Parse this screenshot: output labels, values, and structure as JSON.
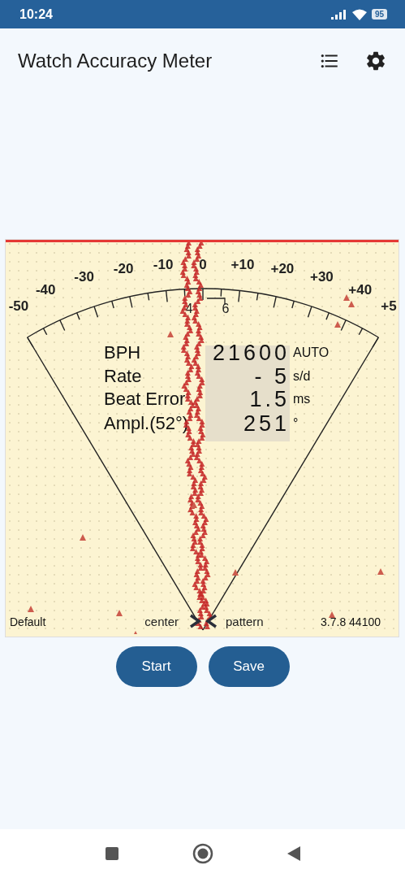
{
  "status_bar": {
    "time": "10:24",
    "battery": "95"
  },
  "app_bar": {
    "title": "Watch Accuracy Meter",
    "actions": [
      {
        "kind": "list"
      },
      {
        "kind": "settings"
      }
    ]
  },
  "meter": {
    "scale_labels": [
      "-50",
      "-40",
      "-30",
      "-20",
      "-10",
      "0",
      "+10",
      "+20",
      "+30",
      "+40",
      "+5"
    ],
    "sub_scale_labels": [
      "4",
      "6"
    ],
    "readings": [
      {
        "label": "BPH",
        "value": "21600",
        "unit": "AUTO"
      },
      {
        "label": "Rate",
        "value": "- 5",
        "unit": "s/d"
      },
      {
        "label": "Beat Error",
        "value": "1.5",
        "unit": "ms"
      },
      {
        "label": "Ampl.(52°)",
        "value": "251",
        "unit": "°"
      }
    ],
    "footer": {
      "mode": "Default",
      "center": "center",
      "pattern": "pattern",
      "version": "3.7.8 44100"
    }
  },
  "buttons": [
    {
      "label": "Start"
    },
    {
      "label": "Save"
    }
  ]
}
